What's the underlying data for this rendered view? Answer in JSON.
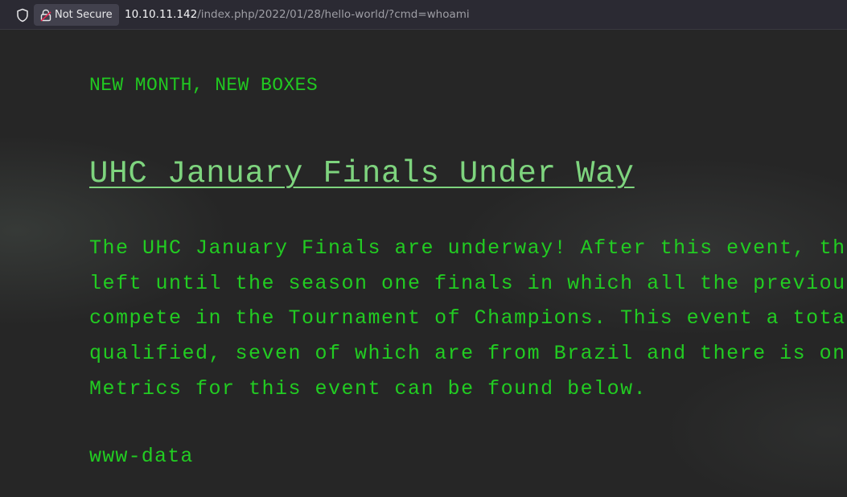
{
  "browser": {
    "security_label": "Not Secure",
    "url_host": "10.10.11.142",
    "url_path": "/index.php/2022/01/28/hello-world/?cmd=whoami",
    "icons": [
      "shield-icon",
      "insecure-lock-icon"
    ]
  },
  "page": {
    "kicker": "NEW MONTH, NEW BOXES",
    "headline": "UHC January Finals Under Way",
    "body_lines": [
      "The UHC January Finals are underway! After this event, the",
      "left until the season one finals in which all the previous",
      "compete in the Tournament of Champions. This event a total",
      "qualified, seven of which are from Brazil and there is one",
      "Metrics for this event can be found below."
    ],
    "command_output": "www-data"
  },
  "colors": {
    "background": "#262626",
    "text_green": "#22cc22",
    "headline_green": "#7ed47e",
    "urlbar": "#2b2a33"
  }
}
